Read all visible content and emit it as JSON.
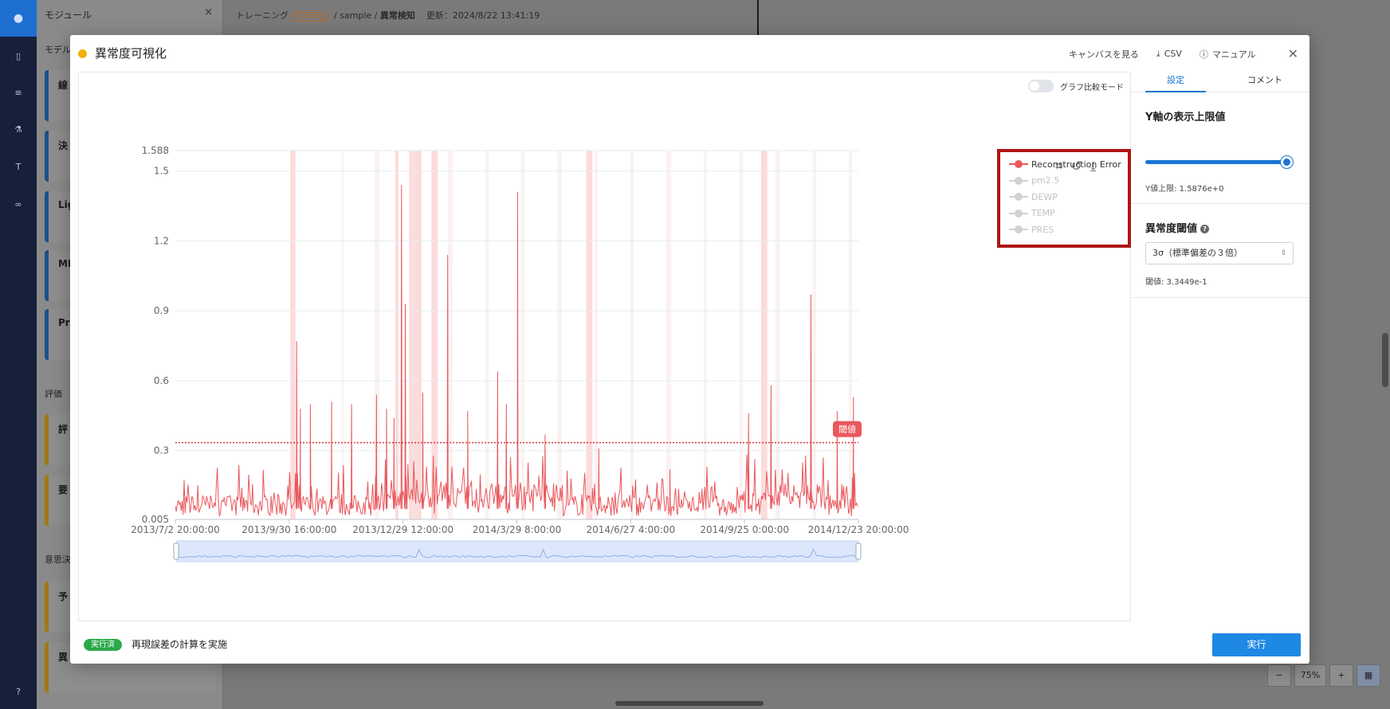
{
  "background": {
    "panel_title": "モジュール",
    "close_glyph": "×",
    "section_model": "モデル",
    "card_labels": [
      "線",
      "決",
      "Lig",
      "ML",
      "Pre"
    ],
    "section_eval": "評価",
    "eval_cards": [
      "評",
      "要"
    ],
    "section_decision": "意思決",
    "decision_cards": [
      "予",
      "異"
    ],
    "breadcrumb_training": "トレーニング",
    "breadcrumb_tag": "Training",
    "breadcrumb_rest": "/ sample /",
    "breadcrumb_current": "異常検知",
    "updated": "更新：2024/8/22 13:41:19",
    "zoom_minus": "−",
    "zoom_level": "75%",
    "zoom_plus": "+"
  },
  "modal": {
    "title": "異常度可視化",
    "view_canvas": "キャンバスを見る",
    "csv": "CSV",
    "manual": "マニュアル",
    "compare_mode": "グラフ比較モード",
    "footer_badge": "実行済",
    "footer_text": "再現誤差の計算を実施",
    "run_label": "実行"
  },
  "side": {
    "tab_settings": "設定",
    "tab_comment": "コメント",
    "y_axis_title": "Y軸の表示上限値",
    "y_limit_text": "Y値上限: 1.5876e+0",
    "y_slider_fraction": 0.95,
    "threshold_title": "異常度閾値",
    "threshold_select": "3σ（標準偏差の３倍）",
    "threshold_value_text": "閾値: 3.3449e-1"
  },
  "chart_data": {
    "type": "line",
    "x_ticks": [
      "2013/7/2 20:00:00",
      "2013/9/30 16:00:00",
      "2013/12/29 12:00:00",
      "2014/3/29 8:00:00",
      "2014/6/27 4:00:00",
      "2014/9/25 0:00:00",
      "2014/12/23 20:00:00"
    ],
    "y_ticks": [
      0.005,
      0.3,
      0.6,
      0.9,
      1.2,
      1.5,
      1.588
    ],
    "ylim": [
      0.005,
      1.588
    ],
    "x_range": [
      "2013/7/2 20:00:00",
      "2014/12/31 23:00:00"
    ],
    "threshold": 0.33449,
    "threshold_label": "閾値",
    "series": [
      {
        "name": "Reconstruction Error",
        "visible": true,
        "color": "#e9585d"
      },
      {
        "name": "pm2.5",
        "visible": false
      },
      {
        "name": "DEWP",
        "visible": false
      },
      {
        "name": "TEMP",
        "visible": false
      },
      {
        "name": "PRES",
        "visible": false
      }
    ],
    "spikes": [
      {
        "x": "2013/10/8",
        "y": 0.77
      },
      {
        "x": "2013/10/11",
        "y": 0.48
      },
      {
        "x": "2013/10/19",
        "y": 0.5
      },
      {
        "x": "2013/11/5",
        "y": 0.51
      },
      {
        "x": "2013/11/21",
        "y": 0.5
      },
      {
        "x": "2013/12/11",
        "y": 0.54
      },
      {
        "x": "2013/12/19",
        "y": 0.48
      },
      {
        "x": "2013/12/25",
        "y": 0.44
      },
      {
        "x": "2013/12/31",
        "y": 1.44
      },
      {
        "x": "2014/1/3",
        "y": 0.93
      },
      {
        "x": "2014/1/17",
        "y": 0.55
      },
      {
        "x": "2014/2/6",
        "y": 1.14
      },
      {
        "x": "2014/2/22",
        "y": 0.47
      },
      {
        "x": "2014/3/18",
        "y": 0.64
      },
      {
        "x": "2014/3/25",
        "y": 0.5
      },
      {
        "x": "2014/4/3",
        "y": 1.41
      },
      {
        "x": "2014/4/25",
        "y": 0.37
      },
      {
        "x": "2014/6/7",
        "y": 0.31
      },
      {
        "x": "2014/8/3",
        "y": 0.22
      },
      {
        "x": "2014/10/5",
        "y": 0.46
      },
      {
        "x": "2014/10/23",
        "y": 0.58
      },
      {
        "x": "2014/11/24",
        "y": 0.97
      },
      {
        "x": "2014/12/15",
        "y": 0.47
      },
      {
        "x": "2014/12/28",
        "y": 0.53
      }
    ],
    "anomaly_bands": [
      {
        "start": "2013/10/3",
        "end": "2013/10/7"
      },
      {
        "start": "2013/12/26",
        "end": "2013/12/28"
      },
      {
        "start": "2014/1/6",
        "end": "2014/1/16"
      },
      {
        "start": "2014/1/24",
        "end": "2014/1/29"
      },
      {
        "start": "2014/5/28",
        "end": "2014/6/2"
      },
      {
        "start": "2014/10/15",
        "end": "2014/10/20"
      }
    ]
  }
}
